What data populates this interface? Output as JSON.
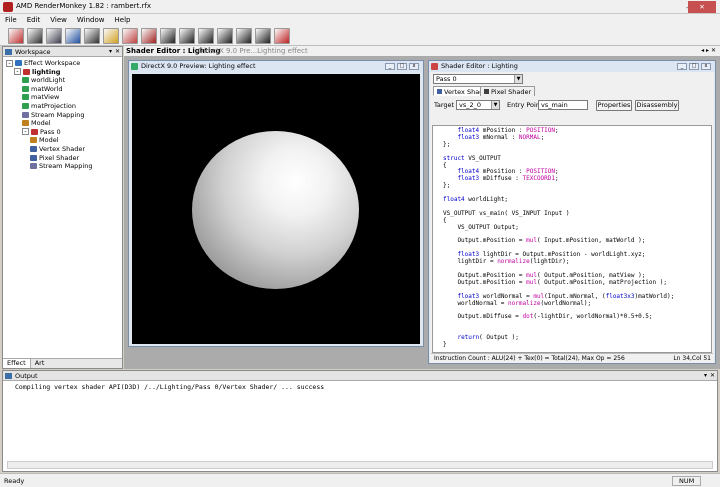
{
  "app": {
    "title": "AMD RenderMonkey 1.82 : rambert.rfx",
    "window_controls": [
      "–",
      "□",
      "✕"
    ]
  },
  "menu": [
    "File",
    "Edit",
    "View",
    "Window",
    "Help"
  ],
  "toolbar": {
    "buttons": [
      {
        "icon": "effect-icon",
        "color": "#c03030"
      },
      {
        "icon": "edit-icon",
        "color": "#303030"
      },
      {
        "icon": "image-icon",
        "color": "#404050"
      },
      {
        "icon": "teapot-icon",
        "color": "#2050a0"
      },
      {
        "icon": "monkey-icon",
        "color": "#303030"
      },
      {
        "icon": "brush-icon",
        "color": "#d0a020"
      },
      {
        "icon": "color-swatch-icon",
        "color": "#c04040"
      },
      {
        "icon": "camera-icon",
        "color": "#a02020"
      },
      {
        "icon": "film-icon",
        "color": "#202020"
      },
      {
        "icon": "film-icon",
        "color": "#202020"
      },
      {
        "icon": "film-icon",
        "color": "#202020"
      },
      {
        "icon": "film-icon",
        "color": "#202020"
      },
      {
        "icon": "film-icon",
        "color": "#202020"
      },
      {
        "icon": "film-icon",
        "color": "#202020"
      },
      {
        "icon": "stop-icon",
        "color": "#c02020"
      }
    ]
  },
  "workspace": {
    "title": "Workspace",
    "tree": [
      {
        "label": "Effect Workspace",
        "indent": 0,
        "icon_color": "#3070c0",
        "exp": "-"
      },
      {
        "label": "lighting",
        "indent": 1,
        "icon_color": "#c03030",
        "exp": "-",
        "bold": true
      },
      {
        "label": "worldLight",
        "indent": 2,
        "icon_color": "#30a050"
      },
      {
        "label": "matWorld",
        "indent": 2,
        "icon_color": "#30a050"
      },
      {
        "label": "matView",
        "indent": 2,
        "icon_color": "#30a050"
      },
      {
        "label": "matProjection",
        "indent": 2,
        "icon_color": "#30a050"
      },
      {
        "label": "Stream Mapping",
        "indent": 2,
        "icon_color": "#7070a0"
      },
      {
        "label": "Model",
        "indent": 2,
        "icon_color": "#c08020"
      },
      {
        "label": "Pass 0",
        "indent": 2,
        "icon_color": "#c03030",
        "exp": "-"
      },
      {
        "label": "Model",
        "indent": 3,
        "icon_color": "#c08020"
      },
      {
        "label": "Vertex Shader",
        "indent": 3,
        "icon_color": "#4060a0"
      },
      {
        "label": "Pixel Shader",
        "indent": 3,
        "icon_color": "#4060a0"
      },
      {
        "label": "Stream Mapping",
        "indent": 3,
        "icon_color": "#7070a0"
      }
    ],
    "tabs": [
      "Effect",
      "Art"
    ]
  },
  "editor_tabs": {
    "active": "Shader Editor : Lighting",
    "inactive": "DirectX 9.0 Pre...Lighting effect",
    "controls": "◂ ▸ ✕"
  },
  "preview": {
    "title": "DirectX 9.0 Preview: Lighting effect",
    "background": "#000000"
  },
  "shader_editor": {
    "title": "Shader Editor : Lighting",
    "pass_select": "Pass 0",
    "tabs": [
      "Vertex Shader",
      "Pixel Shader"
    ],
    "target_label": "Target",
    "target_value": "vs_2_0",
    "entry_label": "Entry Point",
    "entry_value": "vs_main",
    "properties_button": "Properties",
    "disassembly_button": "Disassembly",
    "code_lines": [
      "    float4 mPosition : POSITION;",
      "    float3 mNormal : NORMAL;",
      "};",
      "",
      "struct VS_OUTPUT",
      "{",
      "    float4 mPosition : POSITION;",
      "    float3 mDiffuse : TEXCOORD1;",
      "};",
      "",
      "float4 worldLight;",
      "",
      "VS_OUTPUT vs_main( VS_INPUT Input )",
      "{",
      "    VS_OUTPUT Output;",
      "",
      "    Output.mPosition = mul( Input.mPosition, matWorld );",
      "",
      "    float3 lightDir = Output.mPosition - worldLight.xyz;",
      "    lightDir = normalize(lightDir);",
      "",
      "    Output.mPosition = mul( Output.mPosition, matView );",
      "    Output.mPosition = mul( Output.mPosition, matProjection );",
      "",
      "    float3 worldNormal = mul(Input.mNormal, (float3x3)matWorld);",
      "    worldNormal = normalize(worldNormal);",
      "",
      "    Output.mDiffuse = dot(-lightDir, worldNormal)*0.5+0.5;",
      "",
      "",
      "    return( Output );",
      "}"
    ],
    "status_left": "Instruction Count :  ALU(24) + Tex(0) = Total(24),   Max Op = 256",
    "status_right": "Ln 34,Col 51"
  },
  "output": {
    "title": "Output",
    "text": "Compiling vertex shader API(D3D) /../Lighting/Pass 0/Vertex Shader/ ... success"
  },
  "statusbar": {
    "left": "Ready",
    "right": "NUM"
  }
}
